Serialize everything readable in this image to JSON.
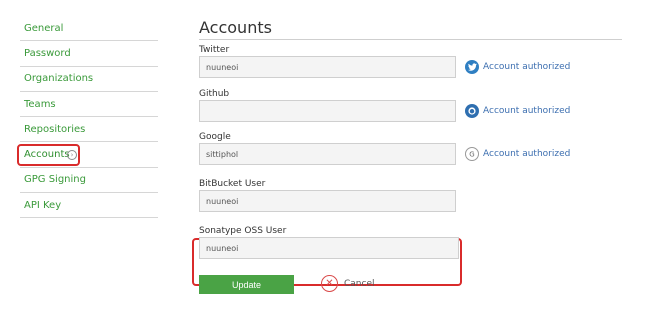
{
  "sidebar": {
    "items": [
      {
        "label": "General"
      },
      {
        "label": "Password"
      },
      {
        "label": "Organizations"
      },
      {
        "label": "Teams"
      },
      {
        "label": "Repositories"
      },
      {
        "label": "Accounts"
      },
      {
        "label": "GPG Signing"
      },
      {
        "label": "API Key"
      }
    ]
  },
  "main": {
    "title": "Accounts",
    "twitter": {
      "label": "Twitter",
      "value": "nuuneoi",
      "auth_text": "Account authorized"
    },
    "github": {
      "label": "Github",
      "value": "",
      "auth_text": "Account authorized"
    },
    "google": {
      "label": "Google",
      "value": "sittiphol",
      "auth_text": "Account authorized"
    },
    "bitbucket": {
      "label": "BitBucket User",
      "value": "nuuneoi"
    },
    "sonatype": {
      "label": "Sonatype OSS User",
      "value": "nuuneoi"
    },
    "update_label": "Update",
    "cancel_label": "Cancel"
  },
  "colors": {
    "accent_green": "#4aa345",
    "link_blue": "#3d6fb0",
    "highlight_red": "#d92b2b"
  }
}
